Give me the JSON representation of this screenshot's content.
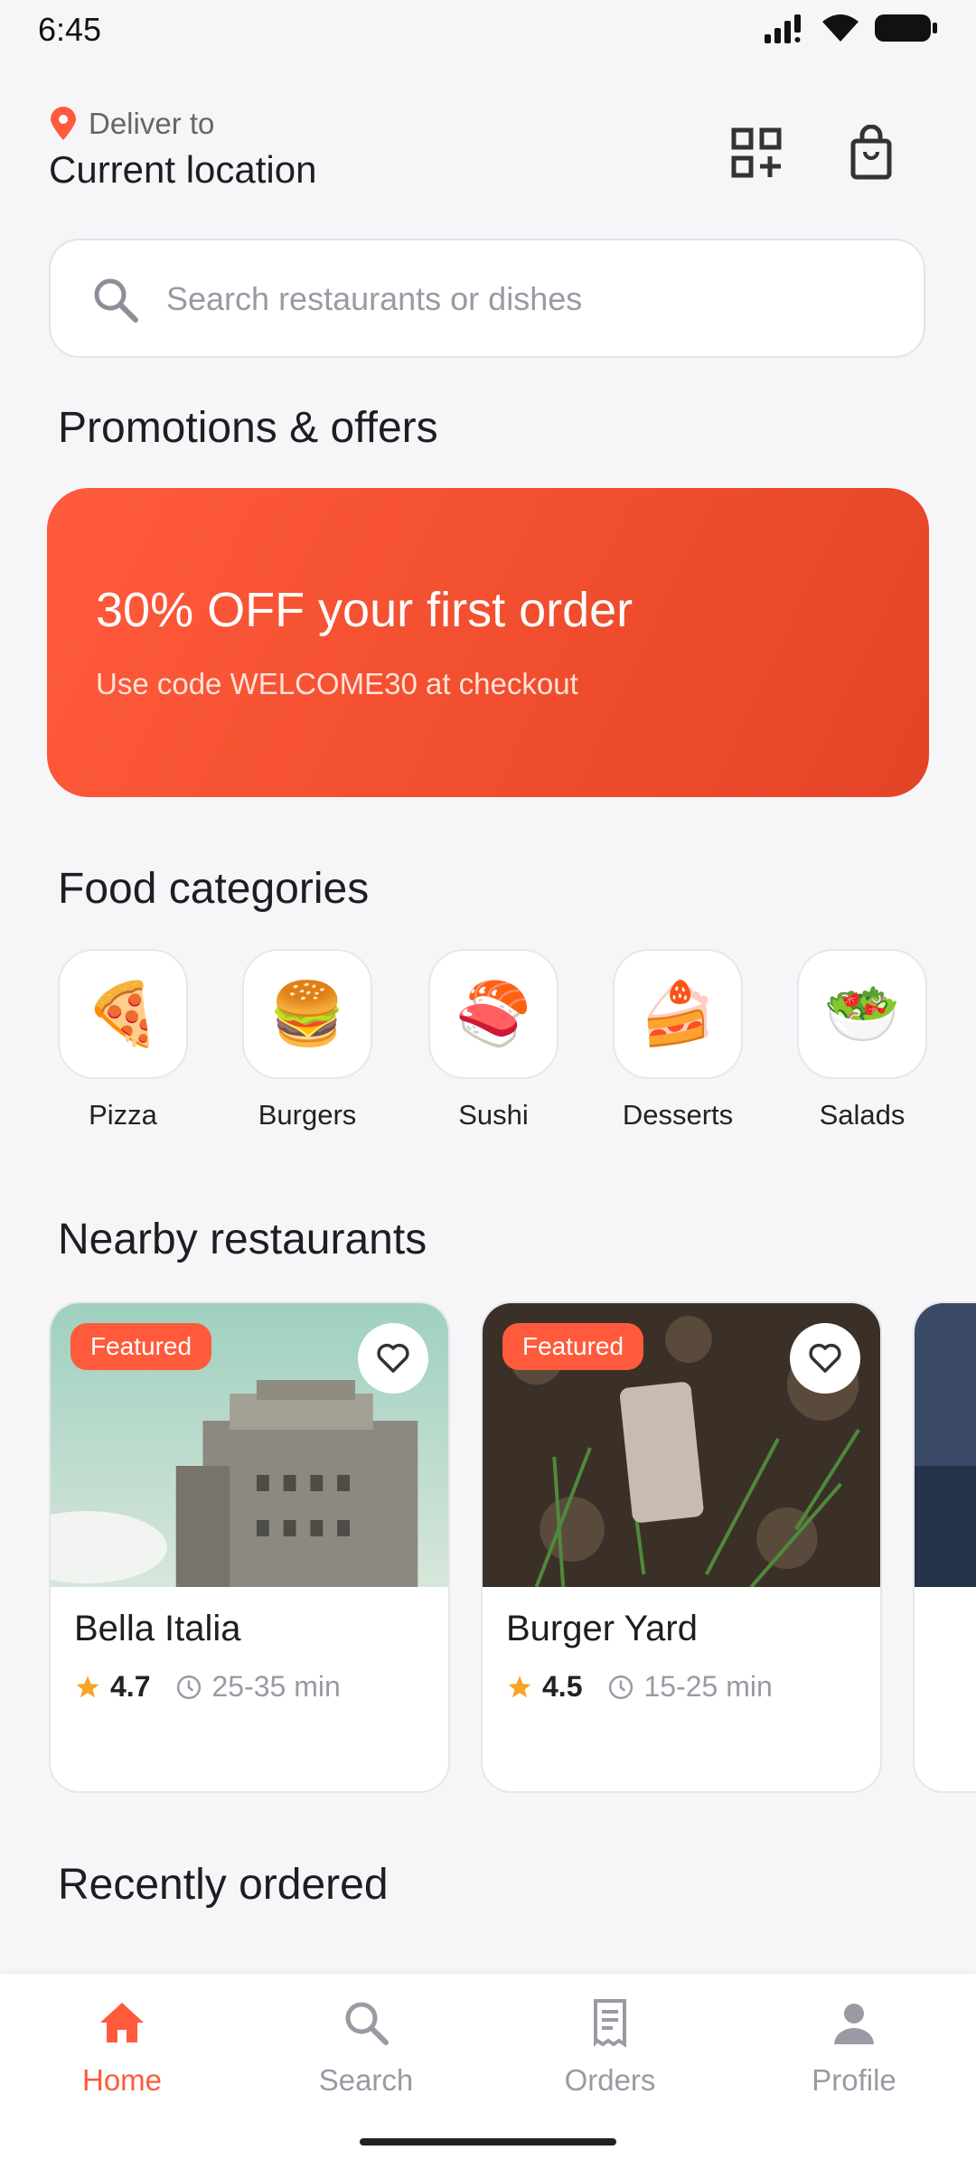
{
  "status_bar": {
    "time": "6:45"
  },
  "header": {
    "deliver_label": "Deliver to",
    "location": "Current location",
    "icons": [
      "location-pin-icon",
      "qr-add-icon",
      "shopping-bag-icon"
    ]
  },
  "search": {
    "placeholder": "Search restaurants or dishes"
  },
  "promotions": {
    "title": "Promotions & offers",
    "headline": "30% OFF your first order",
    "subtitle": "Use code WELCOME30 at checkout"
  },
  "categories": {
    "title": "Food categories",
    "items": [
      {
        "label": "Pizza",
        "emoji": "🍕"
      },
      {
        "label": "Burgers",
        "emoji": "🍔"
      },
      {
        "label": "Sushi",
        "emoji": "🍣"
      },
      {
        "label": "Desserts",
        "emoji": "🍰"
      },
      {
        "label": "Salads",
        "emoji": "🥗"
      }
    ]
  },
  "nearby": {
    "title": "Nearby restaurants",
    "restaurants": [
      {
        "badge": "Featured",
        "name": "Bella Italia",
        "rating": "4.7",
        "time": "25-35 min"
      },
      {
        "badge": "Featured",
        "name": "Burger Yard",
        "rating": "4.5",
        "time": "15-25 min"
      }
    ]
  },
  "recent": {
    "title": "Recently ordered"
  },
  "bottom_nav": {
    "items": [
      {
        "label": "Home",
        "icon": "home-icon",
        "active": true
      },
      {
        "label": "Search",
        "icon": "search-icon",
        "active": false
      },
      {
        "label": "Orders",
        "icon": "receipt-icon",
        "active": false
      },
      {
        "label": "Profile",
        "icon": "person-icon",
        "active": false
      }
    ]
  },
  "colors": {
    "accent": "#FF5A3C",
    "background": "#F6F6F9",
    "muted": "#9A9AA4"
  }
}
